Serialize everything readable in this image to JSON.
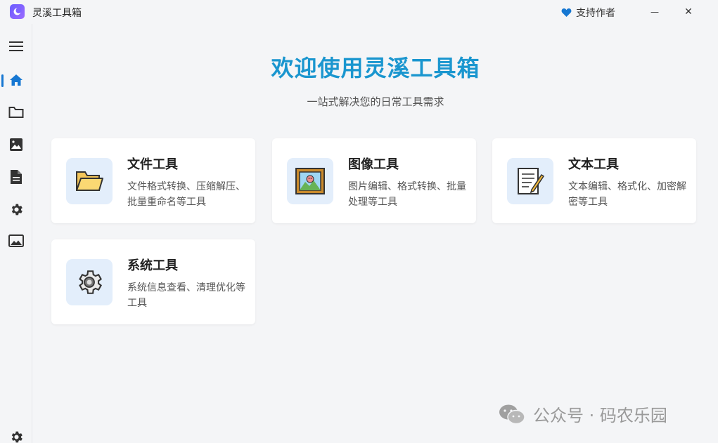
{
  "window": {
    "title": "灵溪工具箱",
    "support_label": "支持作者",
    "minimize_glyph": "—",
    "close_glyph": "✕"
  },
  "sidebar": {
    "items": [
      {
        "name": "menu",
        "icon": "hamburger-icon"
      },
      {
        "name": "home",
        "icon": "home-icon",
        "active": true
      },
      {
        "name": "file-tools",
        "icon": "folder-icon"
      },
      {
        "name": "image-tools",
        "icon": "image-icon"
      },
      {
        "name": "text-tools",
        "icon": "document-icon"
      },
      {
        "name": "system-tools",
        "icon": "gear-icon"
      },
      {
        "name": "wallpaper",
        "icon": "picture-frame-icon"
      },
      {
        "name": "settings",
        "icon": "settings-icon"
      }
    ]
  },
  "hero": {
    "title": "欢迎使用灵溪工具箱",
    "subtitle": "一站式解决您的日常工具需求"
  },
  "cards": [
    {
      "title": "文件工具",
      "desc": "文件格式转换、压缩解压、批量重命名等工具",
      "icon": "folder-icon"
    },
    {
      "title": "图像工具",
      "desc": "图片编辑、格式转换、批量处理等工具",
      "icon": "picture-icon"
    },
    {
      "title": "文本工具",
      "desc": "文本编辑、格式化、加密解密等工具",
      "icon": "notepad-icon"
    },
    {
      "title": "系统工具",
      "desc": "系统信息查看、清理优化等工具",
      "icon": "gear-icon"
    }
  ],
  "watermark": {
    "text": "公众号 · 码农乐园"
  },
  "colors": {
    "accent": "#1677d2",
    "title": "#1a96cf",
    "icon_bg": "#e3eefb"
  }
}
